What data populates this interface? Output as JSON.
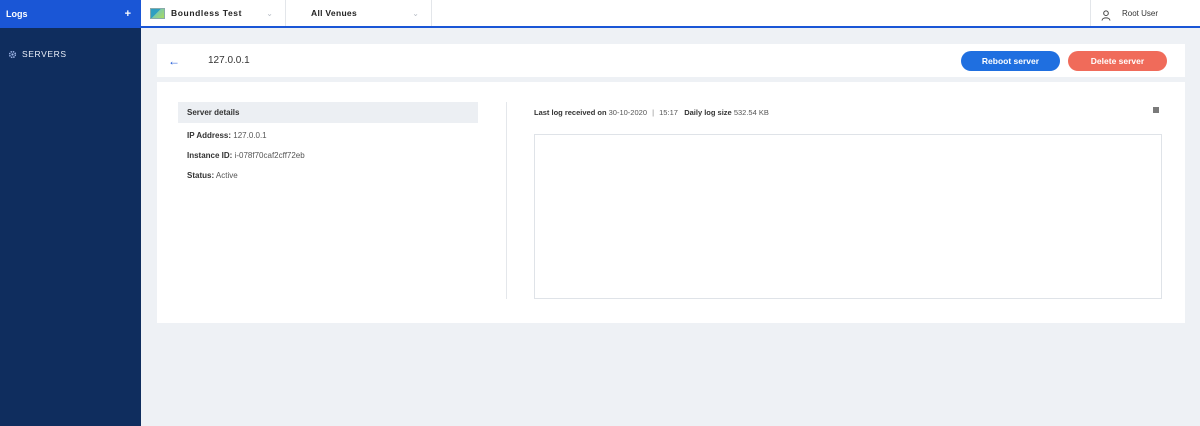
{
  "sidebar": {
    "title": "Logs",
    "add_icon": "plus-icon",
    "items": [
      {
        "label": "SERVERS",
        "icon": "gear-icon"
      }
    ]
  },
  "topbar": {
    "organization": "Boundless Test",
    "venue": "All Venues",
    "user": "Root User"
  },
  "header": {
    "ip": "127.0.0.1",
    "reboot_label": "Reboot server",
    "delete_label": "Delete server"
  },
  "details": {
    "title": "Server details",
    "ip_label": "IP Address:",
    "ip_value": "127.0.0.1",
    "instance_label": "Instance ID:",
    "instance_value": "i-078f70caf2cff72eb",
    "status_label": "Status:",
    "status_value": "Active"
  },
  "log": {
    "received_label": "Last log received on",
    "received_date": "30-10-2020",
    "received_time": "15:17",
    "size_label": "Daily log size",
    "size_value": "532.54 KB"
  },
  "colors": {
    "sidebar_bg": "#0f2d5e",
    "accent": "#1a56d6",
    "reboot": "#1f6fe0",
    "delete": "#f06b5a",
    "page_bg": "#eef1f5"
  }
}
